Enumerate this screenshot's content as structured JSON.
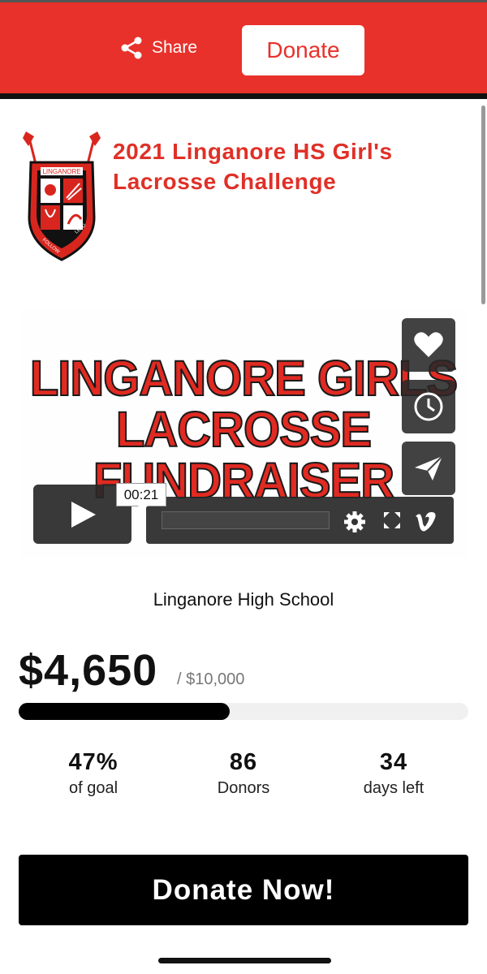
{
  "header": {
    "share_label": "Share",
    "donate_label": "Donate",
    "color": "#e8312a"
  },
  "campaign": {
    "title": "2021 Linganore HS Girl's Lacrosse Challenge",
    "crest_text": "LINGANORE",
    "crest_motto_left": "FOLLOW TODAY",
    "crest_motto_right": "LEAD TOMORROW"
  },
  "video": {
    "overlay_text_line1": "LINGANORE GIRLS",
    "overlay_text_line2": "LACROSSE",
    "overlay_text_line3": "FUNDRAISER",
    "time": "00:21",
    "icons": [
      "heart-icon",
      "clock-icon",
      "send-icon",
      "play-icon",
      "gear-icon",
      "fullscreen-icon",
      "vimeo-icon"
    ]
  },
  "organization": "Linganore High School",
  "fundraising": {
    "raised": "$4,650",
    "goal": "/ $10,000",
    "progress": 0.47
  },
  "stats": [
    {
      "value": "47%",
      "label": "of goal"
    },
    {
      "value": "86",
      "label": "Donors"
    },
    {
      "value": "34",
      "label": "days left"
    }
  ],
  "cta": "Donate Now!"
}
